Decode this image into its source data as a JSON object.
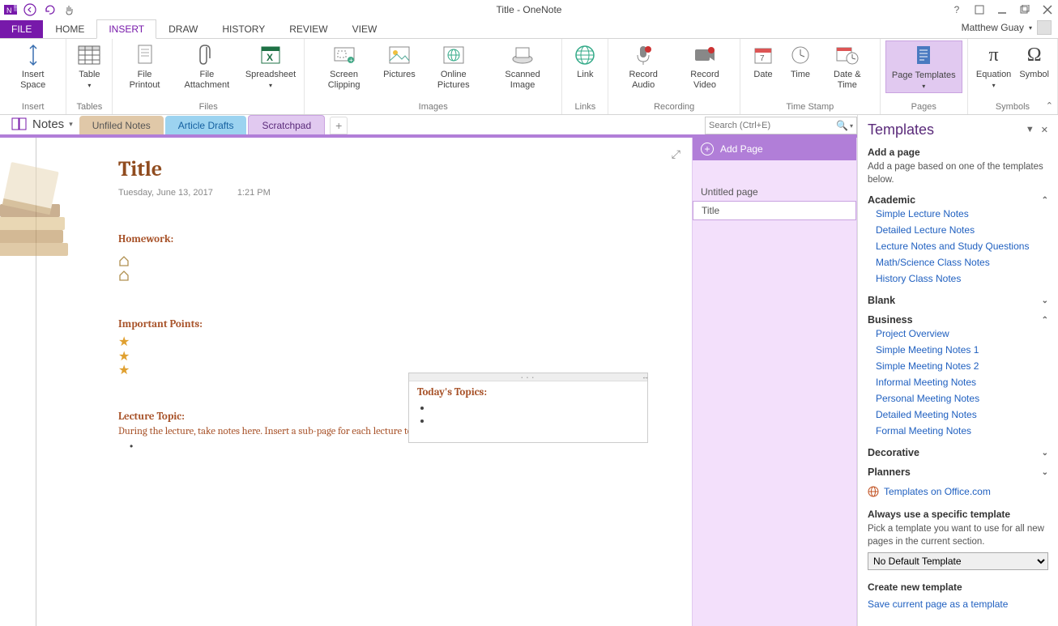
{
  "titlebar": {
    "app_title": "Title - OneNote"
  },
  "ribbon": {
    "file_label": "FILE",
    "tabs": [
      "HOME",
      "INSERT",
      "DRAW",
      "HISTORY",
      "REVIEW",
      "VIEW"
    ],
    "active_tab": "INSERT",
    "user_name": "Matthew Guay",
    "groups": {
      "insert": {
        "label": "Insert",
        "insert_space": "Insert Space"
      },
      "tables": {
        "label": "Tables",
        "table": "Table"
      },
      "files": {
        "label": "Files",
        "printout": "File Printout",
        "attachment": "File Attachment",
        "spreadsheet": "Spreadsheet"
      },
      "images": {
        "label": "Images",
        "clipping": "Screen Clipping",
        "pictures": "Pictures",
        "online_pictures": "Online Pictures",
        "scanned": "Scanned Image"
      },
      "links": {
        "label": "Links",
        "link": "Link"
      },
      "recording": {
        "label": "Recording",
        "audio": "Record Audio",
        "video": "Record Video"
      },
      "timestamp": {
        "label": "Time Stamp",
        "date": "Date",
        "time": "Time",
        "datetime": "Date & Time"
      },
      "pages": {
        "label": "Pages",
        "templates": "Page Templates"
      },
      "symbols": {
        "label": "Symbols",
        "equation": "Equation",
        "symbol": "Symbol"
      }
    }
  },
  "sections": {
    "notebook": "Notes",
    "tabs": {
      "unfiled": "Unfiled Notes",
      "drafts": "Article Drafts",
      "scratch": "Scratchpad"
    },
    "search_placeholder": "Search (Ctrl+E)"
  },
  "pages_panel": {
    "add_page": "Add Page",
    "items": [
      "Untitled page",
      "Title"
    ],
    "active_index": 1
  },
  "page": {
    "title": "Title",
    "date": "Tuesday, June 13, 2017",
    "time": "1:21 PM",
    "homework_heading": "Homework:",
    "important_heading": "Important Points:",
    "lecture_heading": "Lecture Topic:",
    "lecture_text": "During the lecture, take notes here.  Insert a sub-page for each lecture topic.",
    "topics_heading": "Today's Topics:"
  },
  "templates": {
    "pane_title": "Templates",
    "add_page_heading": "Add a page",
    "add_page_hint": "Add a page based on one of the templates below.",
    "categories": [
      {
        "name": "Academic",
        "expanded": true,
        "items": [
          "Simple Lecture Notes",
          "Detailed Lecture Notes",
          "Lecture Notes and Study Questions",
          "Math/Science Class Notes",
          "History Class Notes"
        ]
      },
      {
        "name": "Blank",
        "expanded": false,
        "items": []
      },
      {
        "name": "Business",
        "expanded": true,
        "items": [
          "Project Overview",
          "Simple Meeting Notes 1",
          "Simple Meeting Notes 2",
          "Informal Meeting Notes",
          "Personal Meeting Notes",
          "Detailed Meeting Notes",
          "Formal Meeting Notes"
        ]
      },
      {
        "name": "Decorative",
        "expanded": false,
        "items": []
      },
      {
        "name": "Planners",
        "expanded": false,
        "items": []
      }
    ],
    "office_link": "Templates on Office.com",
    "always_heading": "Always use a specific template",
    "always_hint": "Pick a template you want to use for all new pages in the current section.",
    "default_template": "No Default Template",
    "create_heading": "Create new template",
    "save_link": "Save current page as a template"
  }
}
